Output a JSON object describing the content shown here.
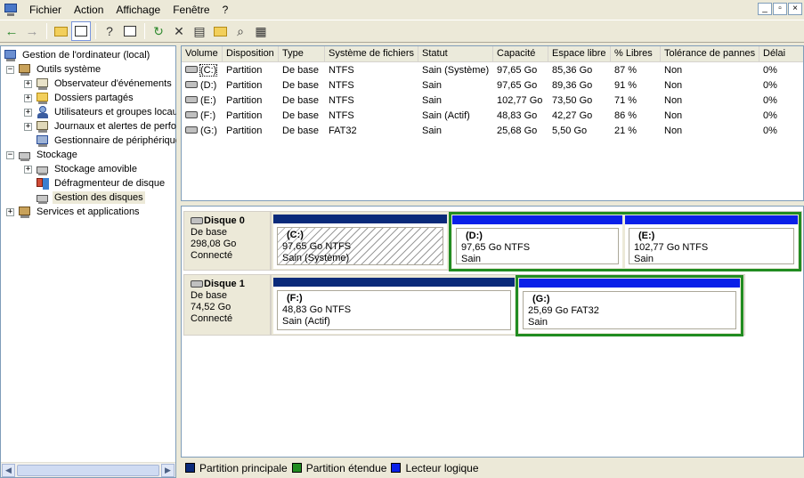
{
  "colors": {
    "primary": "#0a2a7a",
    "extended": "#218c21",
    "logical": "#0a20e8"
  },
  "menu": {
    "items": [
      "Fichier",
      "Action",
      "Affichage",
      "Fenêtre",
      "?"
    ]
  },
  "window_controls": [
    "_",
    "▫",
    "×"
  ],
  "toolbar": {
    "buttons": [
      "back-icon",
      "forward-icon",
      "up-folder-icon",
      "show-hide-tree-icon",
      "help-icon",
      "properties-icon",
      "refresh-icon",
      "delete-icon",
      "export-icon",
      "open-icon",
      "search-icon",
      "disk-properties-icon"
    ]
  },
  "tree": {
    "root": "Gestion de l'ordinateur (local)",
    "outils": "Outils système",
    "observateur": "Observateur d'événements",
    "dossiers": "Dossiers partagés",
    "utilisateurs": "Utilisateurs et groupes locaux",
    "journaux": "Journaux et alertes de performance",
    "gestionnaire": "Gestionnaire de périphériques",
    "stockage": "Stockage",
    "amovible": "Stockage amovible",
    "defrag": "Défragmenteur de disque",
    "disques": "Gestion des disques",
    "services": "Services et applications"
  },
  "columns": [
    "Volume",
    "Disposition",
    "Type",
    "Système de fichiers",
    "Statut",
    "Capacité",
    "Espace libre",
    "% Libres",
    "Tolérance de pannes",
    "Délai"
  ],
  "volumes": [
    {
      "volume": "(C:)",
      "disposition": "Partition",
      "type": "De base",
      "fs": "NTFS",
      "statut": "Sain (Système)",
      "capacite": "97,65 Go",
      "libre": "85,36 Go",
      "pct": "87 %",
      "tol": "Non",
      "delai": "0%"
    },
    {
      "volume": "(D:)",
      "disposition": "Partition",
      "type": "De base",
      "fs": "NTFS",
      "statut": "Sain",
      "capacite": "97,65 Go",
      "libre": "89,36 Go",
      "pct": "91 %",
      "tol": "Non",
      "delai": "0%"
    },
    {
      "volume": "(E:)",
      "disposition": "Partition",
      "type": "De base",
      "fs": "NTFS",
      "statut": "Sain",
      "capacite": "102,77 Go",
      "libre": "73,50 Go",
      "pct": "71 %",
      "tol": "Non",
      "delai": "0%"
    },
    {
      "volume": "(F:)",
      "disposition": "Partition",
      "type": "De base",
      "fs": "NTFS",
      "statut": "Sain (Actif)",
      "capacite": "48,83 Go",
      "libre": "42,27 Go",
      "pct": "86 %",
      "tol": "Non",
      "delai": "0%"
    },
    {
      "volume": "(G:)",
      "disposition": "Partition",
      "type": "De base",
      "fs": "FAT32",
      "statut": "Sain",
      "capacite": "25,68 Go",
      "libre": "5,50 Go",
      "pct": "21 %",
      "tol": "Non",
      "delai": "0%"
    }
  ],
  "disks": [
    {
      "name": "Disque 0",
      "type": "De base",
      "size": "298,08 Go",
      "state": "Connecté",
      "partitions": [
        {
          "label": "(C:)",
          "size": "97,65 Go NTFS",
          "status": "Sain (Système)"
        },
        {
          "label": "(D:)",
          "size": "97,65 Go NTFS",
          "status": "Sain"
        },
        {
          "label": "(E:)",
          "size": "102,77 Go NTFS",
          "status": "Sain"
        }
      ]
    },
    {
      "name": "Disque 1",
      "type": "De base",
      "size": "74,52 Go",
      "state": "Connecté",
      "partitions": [
        {
          "label": "(F:)",
          "size": "48,83 Go NTFS",
          "status": "Sain (Actif)"
        },
        {
          "label": "(G:)",
          "size": "25,69 Go FAT32",
          "status": "Sain"
        }
      ]
    }
  ],
  "legend": [
    "Partition principale",
    "Partition étendue",
    "Lecteur logique"
  ]
}
